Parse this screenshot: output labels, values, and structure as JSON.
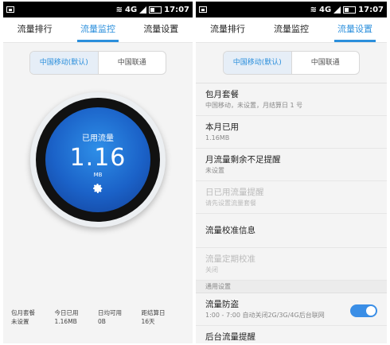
{
  "status": {
    "time": "17:07",
    "network": "4G"
  },
  "tabs": [
    {
      "label": "流量排行"
    },
    {
      "label": "流量监控"
    },
    {
      "label": "流量设置"
    }
  ],
  "carriers": [
    {
      "label": "中国移动(默认)"
    },
    {
      "label": "中国联通"
    }
  ],
  "monitor": {
    "gauge_title": "已用流量",
    "gauge_value": "1.16",
    "gauge_unit": "MB",
    "stats": [
      {
        "label": "包月套餐",
        "value": "未设置"
      },
      {
        "label": "今日已用",
        "value": "1.16MB"
      },
      {
        "label": "日均可用",
        "value": "0B"
      },
      {
        "label": "距结算日",
        "value": "16天"
      }
    ]
  },
  "settings": {
    "items": [
      {
        "title": "包月套餐",
        "subtitle": "中国移动，未设置，月结算日 1 号",
        "disabled": false
      },
      {
        "title": "本月已用",
        "subtitle": "1.16MB",
        "disabled": false
      },
      {
        "title": "月流量剩余不足提醒",
        "subtitle": "未设置",
        "disabled": false
      },
      {
        "title": "日已用流量提醒",
        "subtitle": "请先设置流量套餐",
        "disabled": true
      },
      {
        "title": "流量校准信息",
        "subtitle": "",
        "disabled": false
      },
      {
        "title": "流量定期校准",
        "subtitle": "关闭",
        "disabled": true
      }
    ],
    "section_label": "通用设置",
    "guard": {
      "title": "流量防盗",
      "subtitle": "1:00 - 7:00 自动关闭2G/3G/4G后台联网",
      "enabled": true
    },
    "partial_item": "后台流量提醒"
  },
  "colors": {
    "accent": "#2b8fdc",
    "gauge": "#1b62c8",
    "toggle": "#3a8ee6"
  },
  "icons": [
    "image-icon",
    "wifi-icon",
    "signal-icon",
    "battery-icon",
    "gear-icon"
  ]
}
